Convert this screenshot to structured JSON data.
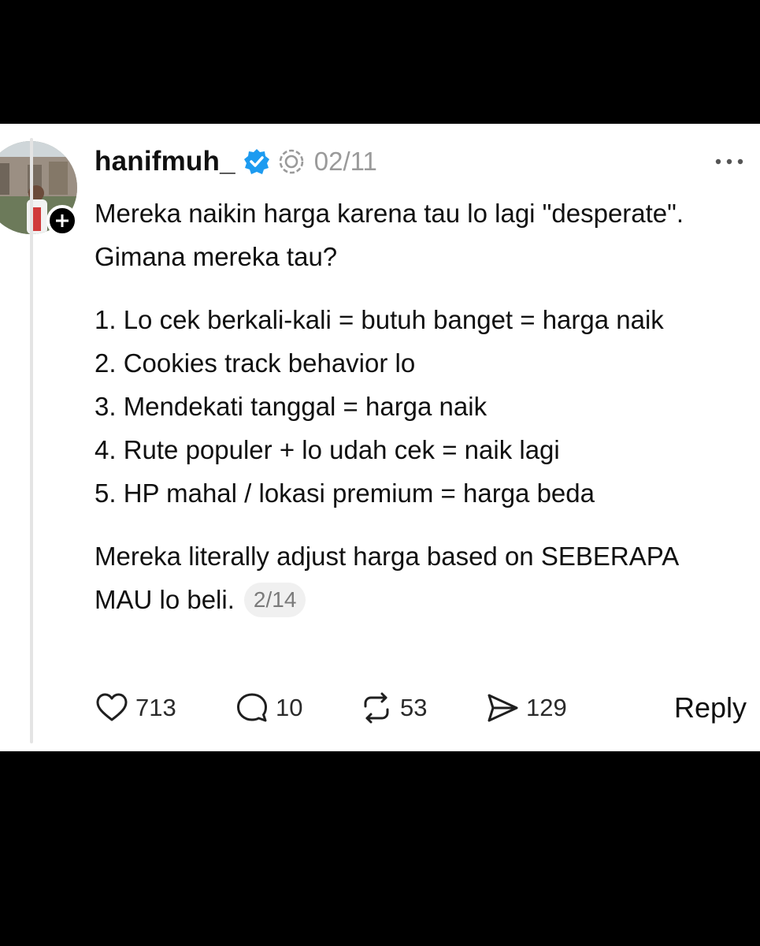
{
  "post": {
    "username": "hanifmuh_",
    "date": "02/11",
    "paragraph1": "Mereka naikin harga karena tau lo lagi \"desperate\". Gimana mereka tau?",
    "list": [
      "1. Lo cek berkali-kali = butuh banget = harga naik",
      "2. Cookies track behavior lo",
      "3. Mendekati tanggal = harga naik",
      "4. Rute populer + lo udah cek = naik lagi",
      "5. HP mahal / lokasi premium = harga beda"
    ],
    "paragraph2": "Mereka literally adjust harga based on SEBERAPA MAU lo beli.",
    "page_indicator": "2/14"
  },
  "actions": {
    "likes": "713",
    "comments": "10",
    "reposts": "53",
    "shares": "129",
    "reply_label": "Reply"
  },
  "icons": {
    "verified": "verified-badge-icon",
    "ai_label": "ai-label-icon",
    "more": "more-options-icon",
    "follow": "plus-icon",
    "like": "heart-icon",
    "comment": "comment-icon",
    "repost": "repost-icon",
    "share": "send-icon"
  },
  "colors": {
    "verified": "#1d9bf0",
    "text": "#101010",
    "muted": "#9a9a9a"
  }
}
